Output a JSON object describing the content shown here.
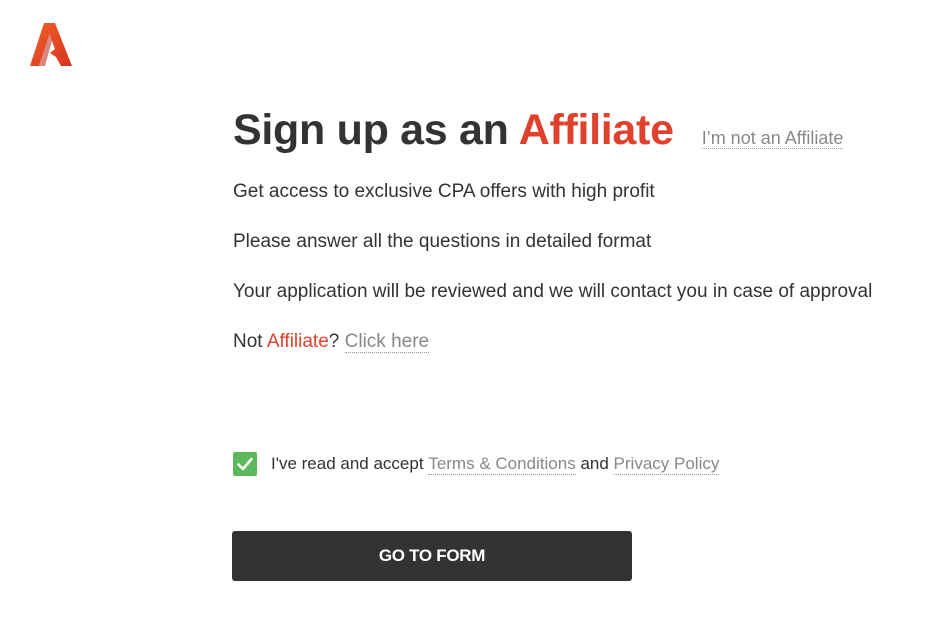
{
  "brand": {
    "logo_icon": "a-letter-logo-icon",
    "accent_color": "#e0412d"
  },
  "header": {
    "title_prefix": "Sign up as an ",
    "title_accent": "Affiliate",
    "not_affiliate_link": "I’m not an Affiliate"
  },
  "info": {
    "line1": "Get access to exclusive CPA offers with high profit",
    "line2": "Please answer all the questions in detailed format",
    "line3": "Your application will be reviewed and we will contact you in case of approval",
    "not_prefix": "Not ",
    "not_accent": "Affiliate",
    "not_suffix": "?",
    "click_here": "Click here"
  },
  "consent": {
    "checked": true,
    "check_color": "#5cb85c",
    "text_prefix": "I've read and accept",
    "terms_link": "Terms & Conditions",
    "and_text": "and",
    "privacy_link": "Privacy Policy"
  },
  "actions": {
    "go_to_form": "GO TO FORM"
  }
}
